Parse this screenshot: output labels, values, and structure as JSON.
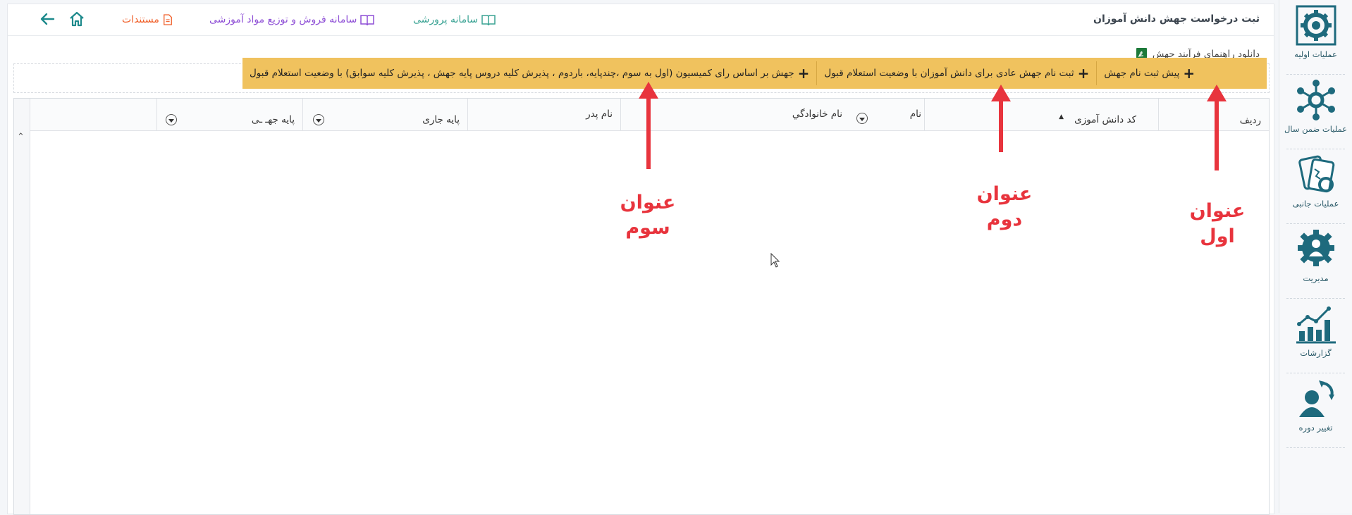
{
  "header": {
    "title": "ثبت درخواست جهش دانش آموزان",
    "links": [
      {
        "label": "سامانه پرورشی",
        "icon": "book-icon",
        "color": "#3aa394"
      },
      {
        "label": "سامانه فروش و توزیع مواد آموزشی",
        "icon": "book-icon",
        "color": "#8e4fd6"
      },
      {
        "label": "مستندات",
        "icon": "document-icon",
        "color": "#f0602a"
      }
    ],
    "home_icon": "home-icon",
    "back_icon": "arrow-left-icon"
  },
  "download": {
    "label": "دانلود راهنمای فرآیند جهش",
    "icon": "pdf-icon"
  },
  "toolbar": {
    "background": "#f0c25e",
    "buttons": [
      {
        "label": "پیش ثبت نام جهش"
      },
      {
        "label": "ثبت نام جهش عادی برای دانش آموزان با وضعیت استعلام قبول"
      },
      {
        "label": "جهش بر اساس رای کمیسیون (اول به سوم ،چندپایه، باردوم ، پذیرش کلیه دروس پایه جهش ، پذیرش کلیه سوابق) با وضعیت استعلام قبول"
      }
    ]
  },
  "grid": {
    "columns": [
      "ردیف",
      "کد دانش آموزی",
      "نام",
      "نام خانوادگي",
      "نام پدر",
      "پایه جاری",
      "پایه جهـ ـی"
    ]
  },
  "sidebar": {
    "items": [
      {
        "label": "عملیات اولیه",
        "icon": "gear-icon"
      },
      {
        "label": "عملیات ضمن سال",
        "icon": "network-icon"
      },
      {
        "label": "عملیات جانبی",
        "icon": "cards-icon"
      },
      {
        "label": "مدیریت",
        "icon": "admin-gear-icon"
      },
      {
        "label": "گزارشات",
        "icon": "chart-icon"
      },
      {
        "label": "تغییر دوره",
        "icon": "user-switch-icon"
      }
    ],
    "accent": "#1e6a7d"
  },
  "annotations": {
    "color": "#e8343d",
    "labels": [
      {
        "line1": "عنوان",
        "line2": "اول"
      },
      {
        "line1": "عنوان",
        "line2": "دوم"
      },
      {
        "line1": "عنوان",
        "line2": "سوم"
      }
    ]
  }
}
